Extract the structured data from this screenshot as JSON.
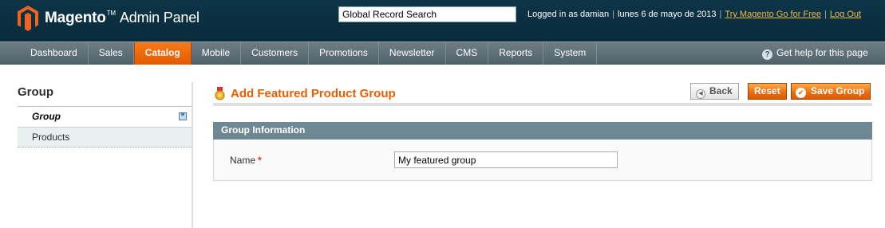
{
  "header": {
    "logo_brand": "Magento",
    "logo_suffix": "Admin Panel",
    "search_value": "Global Record Search",
    "logged_in": "Logged in as damian",
    "date": "lunes 6 de mayo de 2013",
    "try_link": "Try Magento Go for Free",
    "logout_link": "Log Out"
  },
  "nav": {
    "items": [
      "Dashboard",
      "Sales",
      "Catalog",
      "Mobile",
      "Customers",
      "Promotions",
      "Newsletter",
      "CMS",
      "Reports",
      "System"
    ],
    "active": "Catalog",
    "help": "Get help for this page"
  },
  "sidebar": {
    "title": "Group",
    "tabs": [
      {
        "label": "Group",
        "active": true
      },
      {
        "label": "Products",
        "active": false
      }
    ]
  },
  "content": {
    "title": "Add Featured Product Group",
    "buttons": {
      "back": "Back",
      "reset": "Reset",
      "save": "Save Group"
    },
    "fieldset_title": "Group Information",
    "field": {
      "label": "Name",
      "required_mark": "*",
      "value": "My featured group"
    }
  },
  "colors": {
    "accent": "#eb5e00",
    "header_bg": "#0c3547",
    "nav_bg": "#5f7079",
    "fieldset_head": "#6f8992"
  }
}
